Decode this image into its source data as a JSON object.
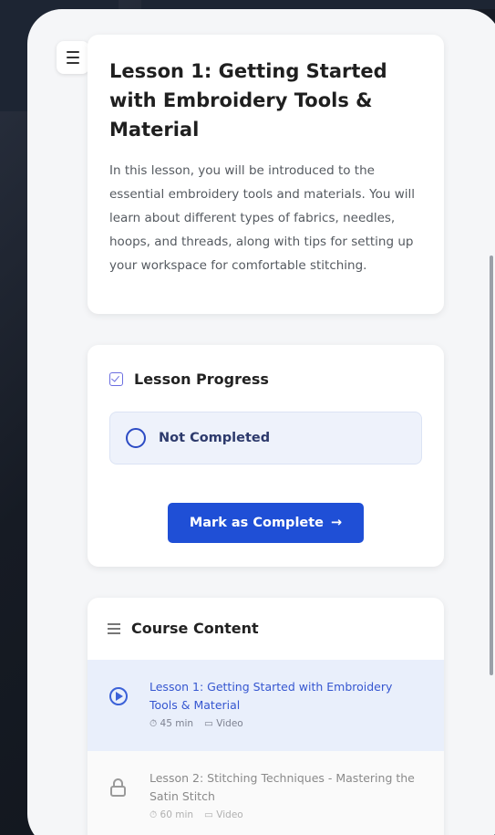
{
  "lesson": {
    "title": "Lesson 1: Getting Started with Embroidery Tools & Material",
    "description": "In this lesson, you will be introduced to the essential embroidery tools and materials. You will learn about different types of fabrics, needles, hoops, and threads, along with tips for setting up your workspace for comfortable stitching."
  },
  "progress": {
    "heading": "Lesson Progress",
    "status": "Not Completed",
    "button_label": "Mark as Complete",
    "button_arrow": "→"
  },
  "course_content": {
    "heading": "Course Content",
    "lessons": [
      {
        "title": "Lesson 1: Getting Started with Embroidery Tools & Material",
        "duration": "45 min",
        "type": "Video",
        "state": "active"
      },
      {
        "title": "Lesson 2: Stitching Techniques - Mastering the Satin Stitch",
        "duration": "60 min",
        "type": "Video",
        "state": "locked"
      }
    ]
  },
  "colors": {
    "accent": "#1f4fd6",
    "active_row": "#e9effb",
    "status_bg": "#eef2fb"
  }
}
